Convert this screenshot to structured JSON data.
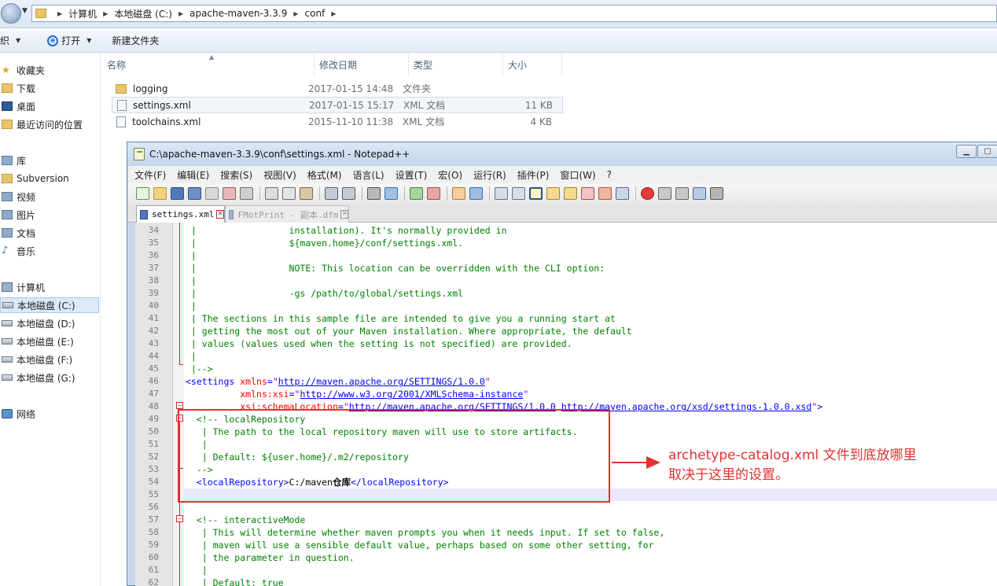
{
  "explorer": {
    "breadcrumb": [
      "计算机",
      "本地磁盘 (C:)",
      "apache-maven-3.3.9",
      "conf"
    ],
    "toolbar": {
      "organize": "织",
      "open": "打开",
      "new_folder": "新建文件夹"
    },
    "nav": {
      "favorites": "收藏夹",
      "downloads": "下载",
      "desktop": "桌面",
      "recent": "最近访问的位置",
      "libraries": "库",
      "subversion": "Subversion",
      "videos": "视频",
      "pictures": "图片",
      "documents": "文档",
      "music": "音乐",
      "computer": "计算机",
      "drives": [
        "本地磁盘 (C:)",
        "本地磁盘 (D:)",
        "本地磁盘 (E:)",
        "本地磁盘 (F:)",
        "本地磁盘 (G:)"
      ],
      "network": "网络"
    },
    "columns": {
      "name": "名称",
      "date": "修改日期",
      "type": "类型",
      "size": "大小"
    },
    "files": [
      {
        "name": "logging",
        "date": "2017-01-15 14:48",
        "type": "文件夹",
        "size": ""
      },
      {
        "name": "settings.xml",
        "date": "2017-01-15 15:17",
        "type": "XML 文档",
        "size": "11 KB"
      },
      {
        "name": "toolchains.xml",
        "date": "2015-11-10 11:38",
        "type": "XML 文档",
        "size": "4 KB"
      }
    ]
  },
  "notepad": {
    "title": "C:\\apache-maven-3.3.9\\conf\\settings.xml - Notepad++",
    "menu": [
      "文件(F)",
      "编辑(E)",
      "搜索(S)",
      "视图(V)",
      "格式(M)",
      "语言(L)",
      "设置(T)",
      "宏(O)",
      "运行(R)",
      "插件(P)",
      "窗口(W)",
      "?"
    ],
    "tabs": [
      "settings.xml",
      "FMotPrint - 副本.dfm"
    ],
    "lines": [
      {
        "n": "34",
        "p": [
          [
            "c",
            " |                 installation). It's normally provided in"
          ]
        ]
      },
      {
        "n": "35",
        "p": [
          [
            "c",
            " |                 ${maven.home}/conf/settings.xml."
          ]
        ]
      },
      {
        "n": "36",
        "p": [
          [
            "c",
            " |"
          ]
        ]
      },
      {
        "n": "37",
        "p": [
          [
            "c",
            " |                 NOTE: This location can be overridden with the CLI option:"
          ]
        ]
      },
      {
        "n": "38",
        "p": [
          [
            "c",
            " |"
          ]
        ]
      },
      {
        "n": "39",
        "p": [
          [
            "c",
            " |                 -gs /path/to/global/settings.xml"
          ]
        ]
      },
      {
        "n": "40",
        "p": [
          [
            "c",
            " |"
          ]
        ]
      },
      {
        "n": "41",
        "p": [
          [
            "c",
            " | The sections in this sample file are intended to give you a running start at"
          ]
        ]
      },
      {
        "n": "42",
        "p": [
          [
            "c",
            " | getting the most out of your Maven installation. Where appropriate, the default"
          ]
        ]
      },
      {
        "n": "43",
        "p": [
          [
            "c",
            " | values (values used when the setting is not specified) are provided."
          ]
        ]
      },
      {
        "n": "44",
        "p": [
          [
            "c",
            " |"
          ]
        ]
      },
      {
        "n": "45",
        "p": [
          [
            "c",
            " |-->"
          ]
        ]
      },
      {
        "n": "46",
        "p": [
          [
            "t",
            "<settings "
          ],
          [
            "a",
            "xmlns"
          ],
          [
            "t",
            "="
          ],
          [
            "v",
            "\""
          ],
          [
            "l",
            "http://maven.apache.org/SETTINGS/1.0.0"
          ],
          [
            "v",
            "\""
          ]
        ]
      },
      {
        "n": "47",
        "p": [
          [
            "x",
            "          "
          ],
          [
            "a",
            "xmlns:xsi"
          ],
          [
            "t",
            "="
          ],
          [
            "v",
            "\""
          ],
          [
            "l",
            "http://www.w3.org/2001/XMLSchema-instance"
          ],
          [
            "v",
            "\""
          ]
        ]
      },
      {
        "n": "48",
        "p": [
          [
            "x",
            "          "
          ],
          [
            "a",
            "xsi:schemaLocation"
          ],
          [
            "t",
            "="
          ],
          [
            "v",
            "\""
          ],
          [
            "l",
            "http://maven.apache.org/SETTINGS/1.0.0"
          ],
          [
            "v",
            " "
          ],
          [
            "l",
            "http://maven.apache.org/xsd/settings-1.0.0.xsd"
          ],
          [
            "v",
            "\""
          ],
          [
            "t",
            ">"
          ]
        ]
      },
      {
        "n": "49",
        "p": [
          [
            "c",
            "  <!-- localRepository"
          ]
        ]
      },
      {
        "n": "50",
        "p": [
          [
            "c",
            "   | The path to the local repository maven will use to store artifacts."
          ]
        ]
      },
      {
        "n": "51",
        "p": [
          [
            "c",
            "   |"
          ]
        ]
      },
      {
        "n": "52",
        "p": [
          [
            "c",
            "   | Default: ${user.home}/.m2/repository"
          ]
        ]
      },
      {
        "n": "53",
        "p": [
          [
            "c",
            "  -->"
          ]
        ]
      },
      {
        "n": "54",
        "p": [
          [
            "x",
            "  "
          ],
          [
            "t",
            "<localRepository>"
          ],
          [
            "x",
            "C:/maven"
          ],
          [
            "z",
            "仓库"
          ],
          [
            "t",
            "</localRepository>"
          ]
        ]
      },
      {
        "n": "55",
        "p": []
      },
      {
        "n": "56",
        "p": []
      },
      {
        "n": "57",
        "p": [
          [
            "c",
            "  <!-- interactiveMode"
          ]
        ]
      },
      {
        "n": "58",
        "p": [
          [
            "c",
            "   | This will determine whether maven prompts you when it needs input. If set to false,"
          ]
        ]
      },
      {
        "n": "59",
        "p": [
          [
            "c",
            "   | maven will use a sensible default value, perhaps based on some other setting, for"
          ]
        ]
      },
      {
        "n": "60",
        "p": [
          [
            "c",
            "   | the parameter in question."
          ]
        ]
      },
      {
        "n": "61",
        "p": [
          [
            "c",
            "   |"
          ]
        ]
      },
      {
        "n": "62",
        "p": [
          [
            "c",
            "   | Default: true"
          ]
        ]
      }
    ]
  },
  "annotation": {
    "line1_name": "archetype-catalog.xml",
    "line1_rest": " 文件到底放哪里",
    "line2": "取决于这里的设置。"
  },
  "colors": {
    "comment": "#008000",
    "tag": "#0000ff",
    "attr": "#ff0000",
    "value": "#8000ff",
    "annotation": "#e53030"
  }
}
